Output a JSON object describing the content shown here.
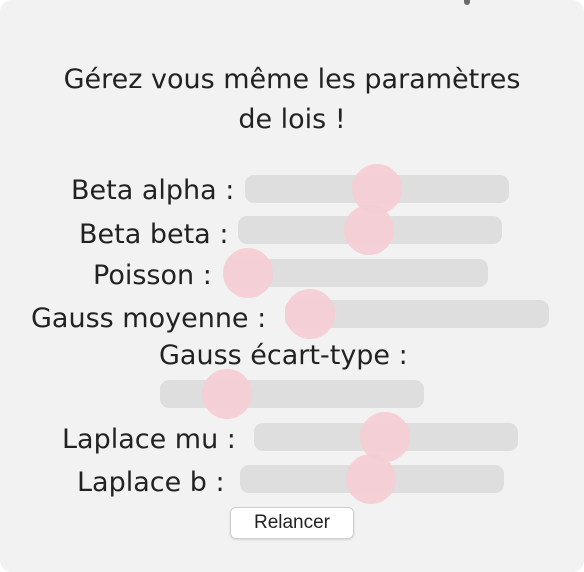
{
  "heading": {
    "line1": "Gérez vous même les paramètres",
    "line2": "de lois !"
  },
  "sliders": [
    {
      "label": "Beta alpha :"
    },
    {
      "label": "Beta beta :"
    },
    {
      "label": "Poisson :"
    },
    {
      "label": "Gauss moyenne :"
    },
    {
      "label": "Gauss écart-type :"
    },
    {
      "label": "Laplace mu :"
    },
    {
      "label": "Laplace b :"
    }
  ],
  "colors": {
    "panel": "#f2f2f2",
    "track": "#dedede",
    "thumb": "#f4cdd4"
  },
  "button": {
    "label": "Relancer"
  }
}
